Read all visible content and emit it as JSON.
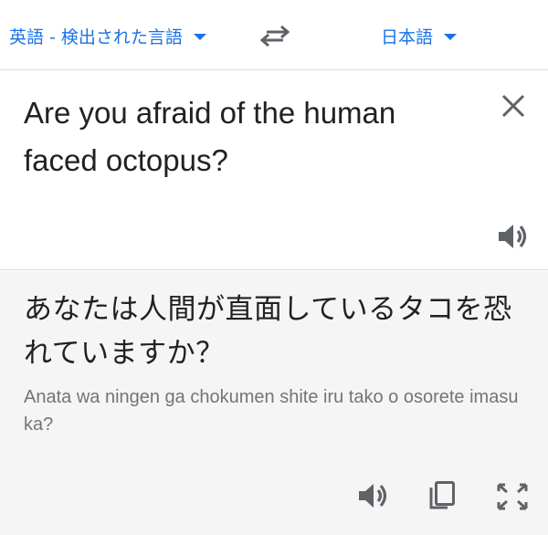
{
  "language_bar": {
    "source_label": "英語 - 検出された言語",
    "target_label": "日本語",
    "swap_icon": "swap-arrows-icon"
  },
  "source": {
    "text": "Are you afraid of the human faced octopus?",
    "clear_icon": "close-icon",
    "speak_icon": "speaker-icon"
  },
  "result": {
    "text": "あなたは人間が直面しているタコを恐れていますか？",
    "romanization": "Anata wa ningen ga chokumen shite iru tako o osorete imasu ka?",
    "speak_icon": "speaker-icon",
    "copy_icon": "copy-icon",
    "fullscreen_icon": "fullscreen-icon"
  },
  "colors": {
    "accent": "#1a73e8",
    "text": "#202124",
    "secondary_text": "#70757a",
    "icon": "#5f6368",
    "result_bg": "#f5f5f5",
    "divider": "#dadce0"
  }
}
